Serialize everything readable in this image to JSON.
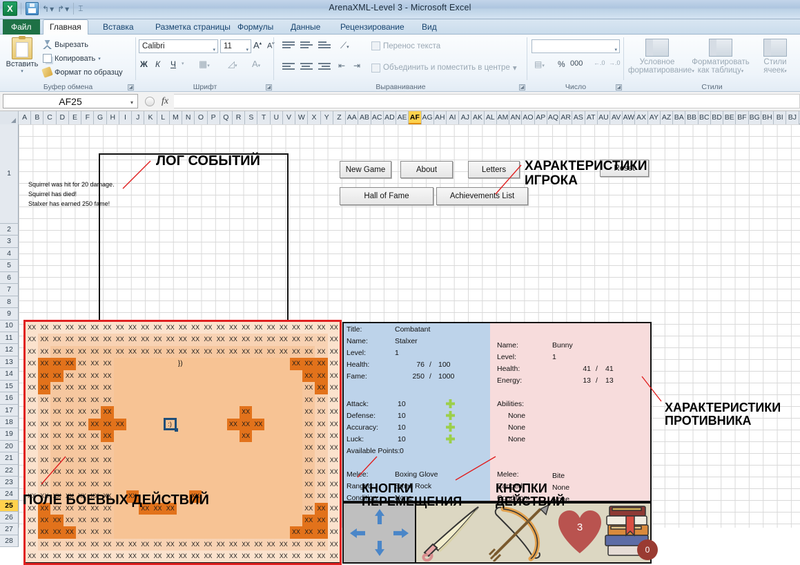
{
  "window": {
    "title": "ArenaXML-Level 3  -  Microsoft Excel",
    "app_logo": "excel-logo",
    "quick_access": [
      "save-icon",
      "undo-icon",
      "redo-icon",
      "customize-qat-icon"
    ]
  },
  "ribbon": {
    "tabs": [
      {
        "label": "Файл",
        "kind": "file"
      },
      {
        "label": "Главная",
        "kind": "active"
      },
      {
        "label": "Вставка",
        "kind": "normal"
      },
      {
        "label": "Разметка страницы",
        "kind": "normal"
      },
      {
        "label": "Формулы",
        "kind": "normal"
      },
      {
        "label": "Данные",
        "kind": "normal"
      },
      {
        "label": "Рецензирование",
        "kind": "normal"
      },
      {
        "label": "Вид",
        "kind": "normal"
      }
    ],
    "groups": {
      "clipboard": {
        "name": "Буфер обмена",
        "paste": "Вставить",
        "items": [
          "Вырезать",
          "Копировать",
          "Формат по образцу"
        ]
      },
      "font": {
        "name": "Шрифт",
        "family": "Calibri",
        "size": "11",
        "bold": "Ж",
        "italic": "К",
        "underline": "Ч",
        "grow": "A",
        "shrink": "A"
      },
      "alignment": {
        "name": "Выравнивание",
        "wrap_text": "Перенос текста",
        "merge_center": "Объединить и поместить в центре"
      },
      "number": {
        "name": "Число",
        "format": "",
        "percent": "%",
        "thousands": "000"
      },
      "styles": {
        "name": "Стили",
        "conditional": "Условное\nформатирование",
        "as_table": "Форматировать\nкак таблицу",
        "cell_styles": "Стили\nячеек"
      }
    }
  },
  "formula_bar": {
    "name_box": "AF25",
    "fx": "fx",
    "formula": ""
  },
  "sheet": {
    "columns": [
      "A",
      "B",
      "C",
      "D",
      "E",
      "F",
      "G",
      "H",
      "I",
      "J",
      "K",
      "L",
      "M",
      "N",
      "O",
      "P",
      "Q",
      "R",
      "S",
      "T",
      "U",
      "V",
      "W",
      "X",
      "Y",
      "Z",
      "AA",
      "AB",
      "AC",
      "AD",
      "AE",
      "AF",
      "AG",
      "AH",
      "AI",
      "AJ",
      "AK",
      "AL",
      "AM",
      "AN",
      "AO",
      "AP",
      "AQ",
      "AR",
      "AS",
      "AT",
      "AU",
      "AV",
      "AW",
      "AX",
      "AY",
      "AZ",
      "BA",
      "BB",
      "BC",
      "BD",
      "BE",
      "BF",
      "BG",
      "BH",
      "BI",
      "BJ"
    ],
    "selected_column": "AF",
    "rows": [
      "1",
      "2",
      "3",
      "4",
      "5",
      "6",
      "7",
      "8",
      "9",
      "10",
      "11",
      "12",
      "13",
      "14",
      "15",
      "16",
      "17",
      "18",
      "19",
      "20",
      "21",
      "22",
      "23",
      "24",
      "25",
      "26",
      "27",
      "28"
    ],
    "selected_row": "25"
  },
  "game": {
    "buttons": [
      {
        "label": "New Game",
        "name": "new-game-button"
      },
      {
        "label": "About",
        "name": "about-button"
      },
      {
        "label": "Letters",
        "name": "letters-button"
      },
      {
        "label": "Reset",
        "name": "reset-button"
      },
      {
        "label": "Hall of Fame",
        "name": "hall-of-fame-button"
      },
      {
        "label": "Achievements List",
        "name": "achievements-list-button"
      }
    ],
    "log": [
      "Squirrel was hit for 20 damage.",
      "Squirrel has died!",
      "Stalxer has earned 250 fame!"
    ],
    "player_marker": ":)",
    "brace_marker": "})",
    "cell_token": "XX",
    "player_panel": {
      "rows": [
        {
          "label": "Title:",
          "value": "Combatant"
        },
        {
          "label": "Name:",
          "value": "Stalxer"
        },
        {
          "label": "Level:",
          "value": "1"
        }
      ],
      "health": {
        "label": "Health:",
        "cur": "76",
        "sep": "/",
        "max": "100"
      },
      "fame": {
        "label": "Fame:",
        "cur": "250",
        "sep": "/",
        "max": "1000"
      },
      "stats": [
        {
          "label": "Attack:",
          "value": "10",
          "plus": true
        },
        {
          "label": "Defense:",
          "value": "10",
          "plus": true
        },
        {
          "label": "Accuracy:",
          "value": "10",
          "plus": true
        },
        {
          "label": "Luck:",
          "value": "10",
          "plus": true
        },
        {
          "label": "Available Points:",
          "value": "0",
          "plus": false
        }
      ],
      "gear": [
        {
          "label": "Melee:",
          "value": "Boxing Glove"
        },
        {
          "label": "Ranged:",
          "value": "Small Rock"
        },
        {
          "label": "Condition:",
          "value": "None"
        }
      ]
    },
    "enemy_panel": {
      "rows": [
        {
          "label": "Name:",
          "value": "Bunny"
        },
        {
          "label": "Level:",
          "value": "1"
        }
      ],
      "health": {
        "label": "Health:",
        "cur": "41",
        "sep": "/",
        "max": "41"
      },
      "energy": {
        "label": "Energy:",
        "cur": "13",
        "sep": "/",
        "max": "13"
      },
      "abilities_label": "Abilities:",
      "abilities": [
        "None",
        "None",
        "None"
      ],
      "gear": [
        {
          "label": "Melee:",
          "value": "Bite"
        },
        {
          "label": "Ranged:",
          "value": "None"
        },
        {
          "label": "Condition:",
          "value": "None"
        }
      ]
    },
    "action_bar": {
      "move_icon": "four-way-arrows-icon",
      "melee_icon": "sword-icon",
      "ranged_icon": "bow-and-arrow-icon",
      "heal_icon": "heart-icon",
      "heal_count": "3",
      "books_icon": "books-icon",
      "books_count": "0"
    },
    "colors": {
      "field_outer": "#fbe2cd",
      "field_inner": "#f7c394",
      "block": "#e2721b",
      "player_box": "#1f4e79",
      "player_panel": "#bdd3ea",
      "enemy_panel": "#f7dcdc",
      "annotation_line": "#e02020",
      "move_arrow": "#4a86c8",
      "heart": "#b9534f"
    }
  },
  "annotations": [
    {
      "name": "annotation-event-log",
      "text": "ЛОГ СОБЫТИЙ"
    },
    {
      "name": "annotation-player-stats",
      "text": "ХАРАКТЕРИСТИКИ\nИГРОКА"
    },
    {
      "name": "annotation-enemy-stats",
      "text": "ХАРАКТЕРИСТИКИ\nПРОТИВНИКА"
    },
    {
      "name": "annotation-battlefield",
      "text": "ПОЛЕ БОЕВЫХ ДЕЙСТВИЙ"
    },
    {
      "name": "annotation-move-buttons",
      "text": "КНОПКИ\nПЕРЕМЕЩЕНИЯ"
    },
    {
      "name": "annotation-action-buttons",
      "text": "КНОПКИ\nДЕЙСТВИЙ"
    }
  ],
  "battlefield": {
    "cols": 25,
    "rows": 20,
    "blocks": [
      [
        3,
        1
      ],
      [
        3,
        2
      ],
      [
        3,
        3
      ],
      [
        4,
        1
      ],
      [
        4,
        2
      ],
      [
        5,
        1
      ],
      [
        3,
        21
      ],
      [
        3,
        22
      ],
      [
        3,
        23
      ],
      [
        4,
        22
      ],
      [
        4,
        23
      ],
      [
        5,
        23
      ],
      [
        7,
        6
      ],
      [
        8,
        5
      ],
      [
        8,
        6
      ],
      [
        8,
        7
      ],
      [
        9,
        6
      ],
      [
        7,
        17
      ],
      [
        8,
        16
      ],
      [
        8,
        17
      ],
      [
        8,
        18
      ],
      [
        9,
        17
      ],
      [
        14,
        8
      ],
      [
        14,
        13
      ],
      [
        15,
        9
      ],
      [
        15,
        10
      ],
      [
        15,
        11
      ],
      [
        15,
        1
      ],
      [
        16,
        1
      ],
      [
        16,
        2
      ],
      [
        17,
        1
      ],
      [
        17,
        2
      ],
      [
        17,
        3
      ],
      [
        15,
        23
      ],
      [
        16,
        22
      ],
      [
        16,
        23
      ],
      [
        17,
        21
      ],
      [
        17,
        22
      ],
      [
        17,
        23
      ]
    ],
    "player": [
      8,
      11
    ],
    "brace": [
      3,
      12
    ]
  }
}
